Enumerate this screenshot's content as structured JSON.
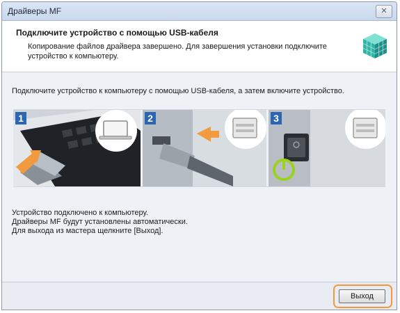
{
  "window": {
    "title": "Драйверы MF",
    "close_glyph": "✕"
  },
  "header": {
    "title": "Подключите устройство с помощью USB-кабеля",
    "description": "Копирование файлов драйвера завершено. Для завершения установки подключите устройство к компьютеру.",
    "icon": "installer-box-icon"
  },
  "content": {
    "instruction": "Подключите устройство к компьютеру с помощью USB-кабеля, а затем включите устройство.",
    "steps": [
      {
        "number": "1",
        "icon": "usb-plug-laptop-illustration"
      },
      {
        "number": "2",
        "icon": "usb-plug-printer-illustration"
      },
      {
        "number": "3",
        "icon": "power-switch-illustration"
      }
    ],
    "status_lines": [
      "Устройство подключено к компьютеру.",
      "Драйверы MF будут установлены автоматически.",
      "Для выхода из мастера щелкните [Выход]."
    ]
  },
  "footer": {
    "exit_label": "Выход"
  },
  "colors": {
    "accent": "#f29a3b",
    "step_badge": "#2b66b3",
    "power_green": "#9bd11f"
  }
}
